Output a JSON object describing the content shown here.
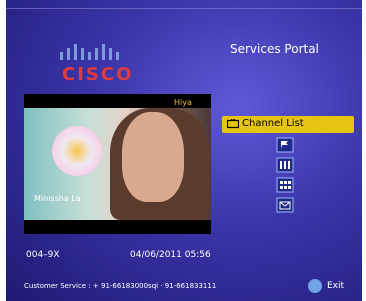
{
  "brand": {
    "logo_text": "CISCO"
  },
  "header": {
    "title": "Services Portal"
  },
  "video": {
    "caption": "Minissha La",
    "channel_logo": "Hiya"
  },
  "menu": {
    "active_item": {
      "label": "Channel List",
      "icon": "tv-icon"
    },
    "icons": [
      "flag-icon",
      "settings-icon",
      "grid-icon",
      "mail-icon"
    ]
  },
  "status": {
    "channel": "004–9X",
    "datetime": "04/06/2011 05:56"
  },
  "footer": {
    "customer_service": "Customer Service :  + 91-66183000sqi · 91-661833111",
    "exit_label": "Exit"
  },
  "colors": {
    "background": "#3a34a8",
    "highlight": "#e5c412",
    "logo": "#e23b3b"
  }
}
